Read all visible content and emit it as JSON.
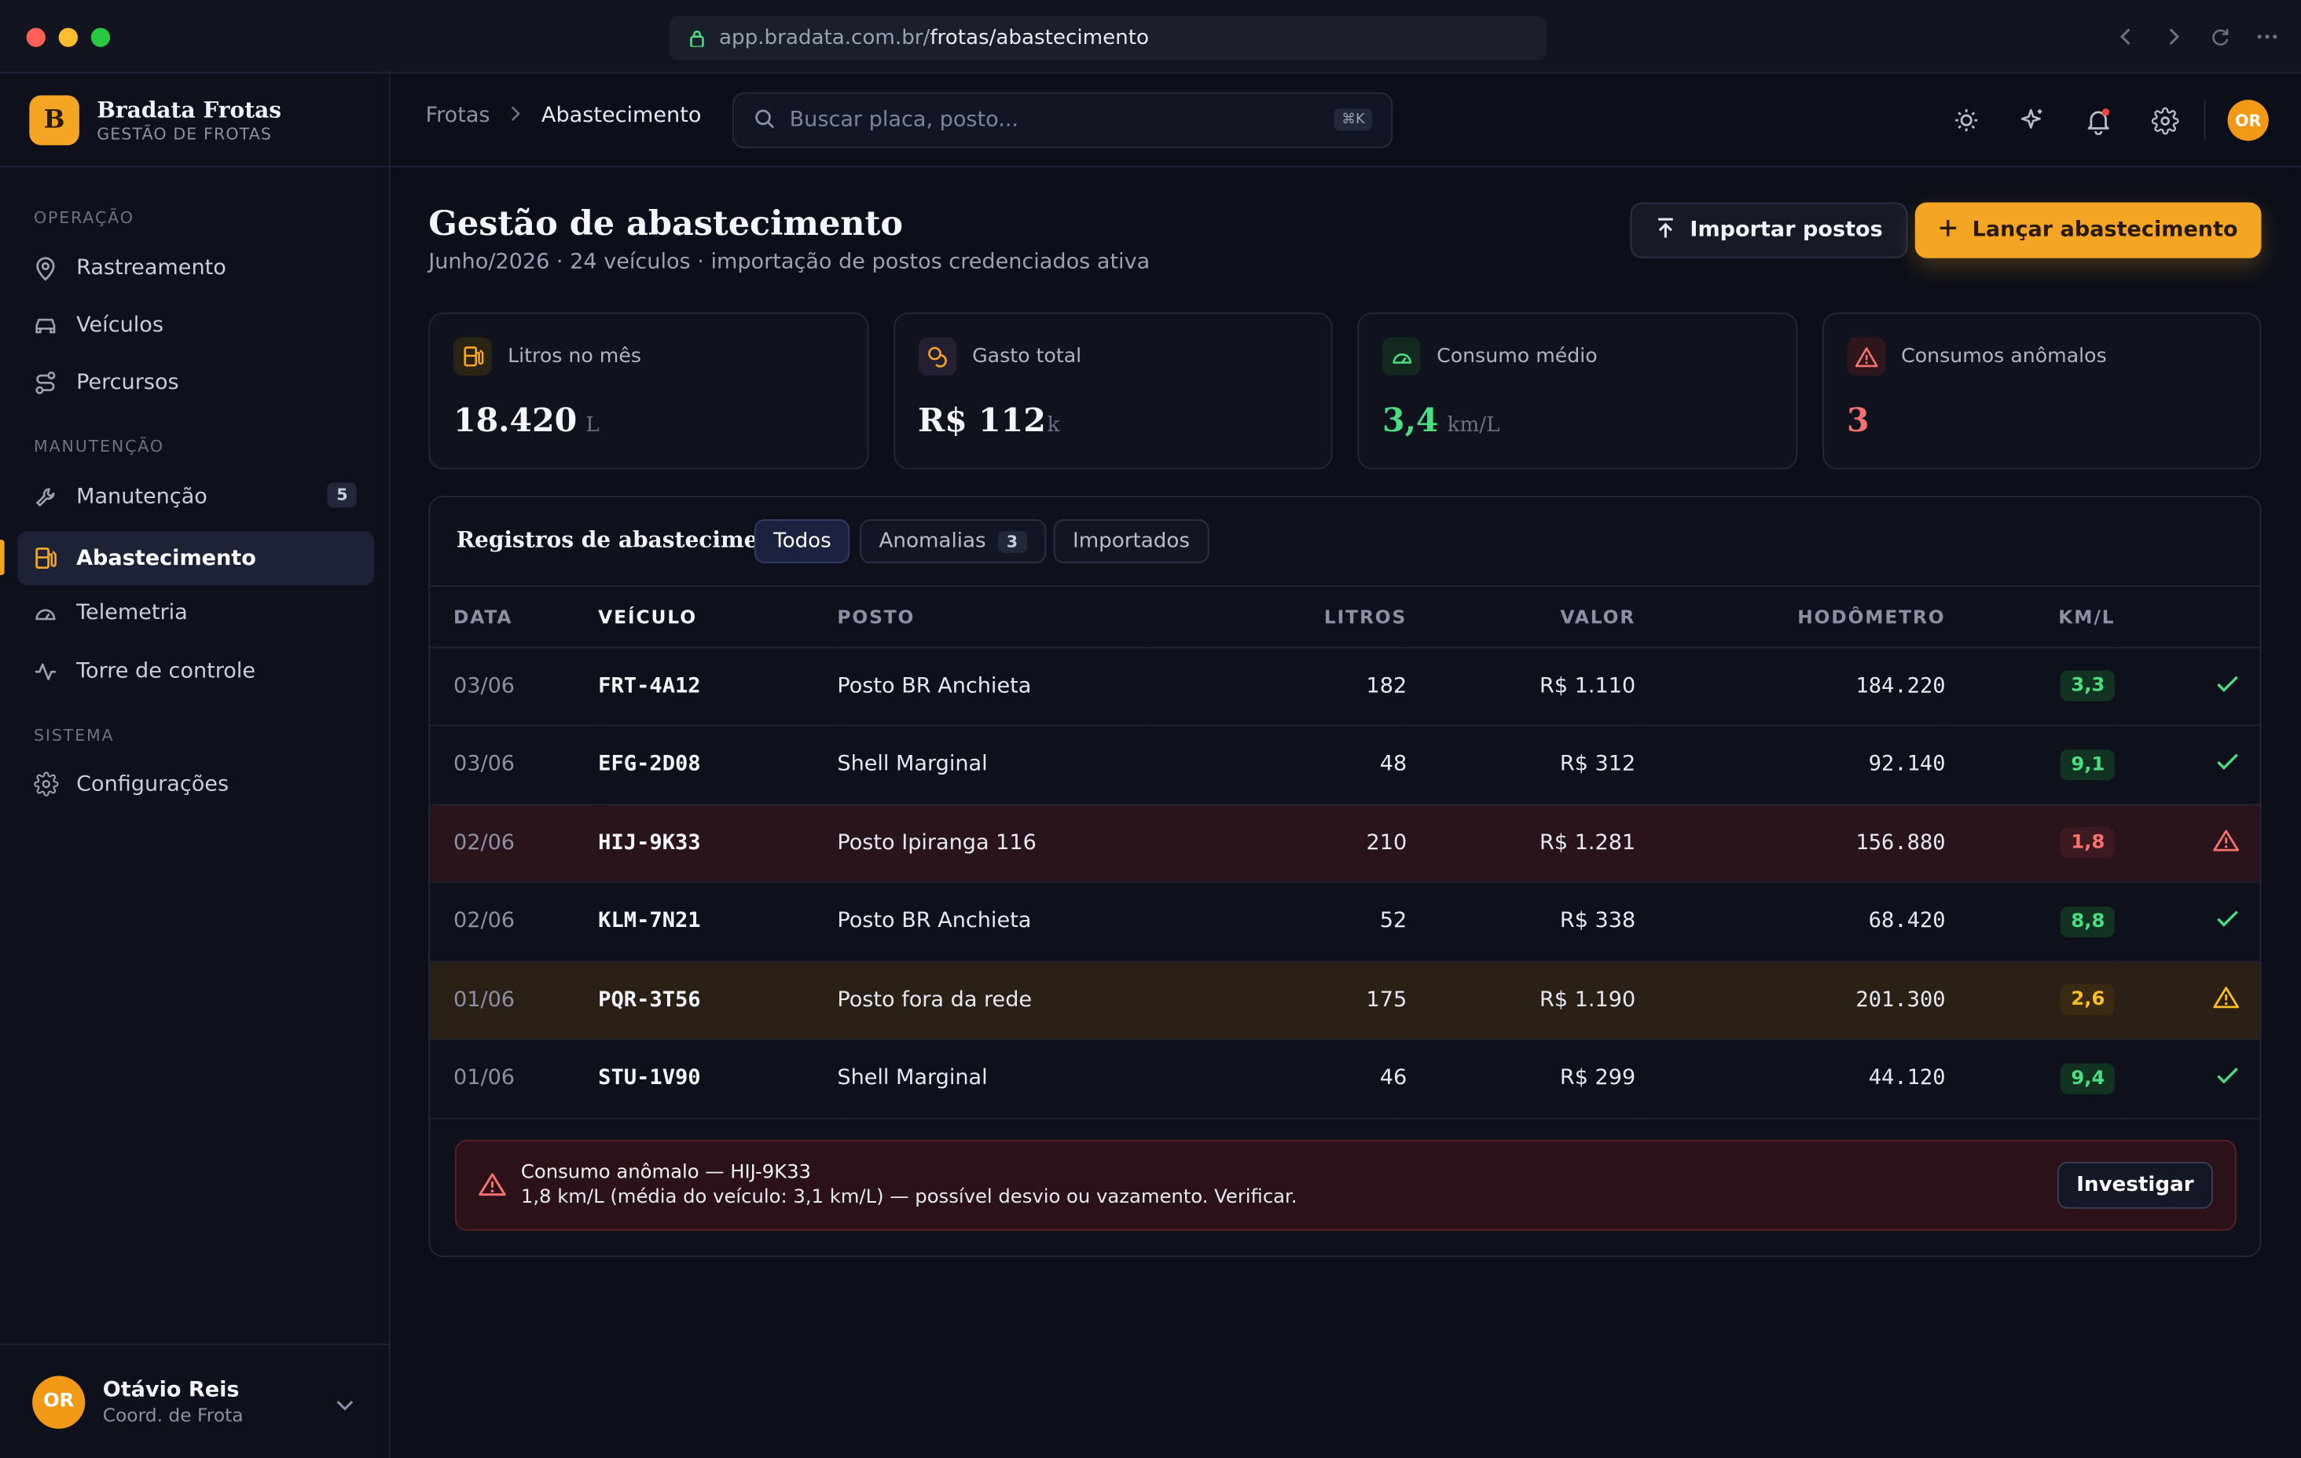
{
  "browser": {
    "url_host": "app.bradata.com.br/",
    "url_path": "frotas/abastecimento"
  },
  "brand": {
    "name": "Bradata Frotas",
    "subtitle": "GESTÃO DE FROTAS",
    "logo_letter": "B",
    "accent": "#f5a524"
  },
  "sidebar": {
    "sections": [
      {
        "label": "OPERAÇÃO"
      },
      {
        "label": "MANUTENÇÃO"
      },
      {
        "label": "SISTEMA"
      }
    ],
    "items": [
      {
        "label": "Rastreamento",
        "icon": "map-pin-icon"
      },
      {
        "label": "Veículos",
        "icon": "car-icon"
      },
      {
        "label": "Percursos",
        "icon": "route-icon"
      },
      {
        "label": "Manutenção",
        "icon": "wrench-icon",
        "badge": "5"
      },
      {
        "label": "Abastecimento",
        "icon": "fuel-icon",
        "active": true
      },
      {
        "label": "Telemetria",
        "icon": "gauge-icon"
      },
      {
        "label": "Torre de controle",
        "icon": "activity-icon"
      },
      {
        "label": "Configurações",
        "icon": "gear-icon"
      }
    ],
    "user": {
      "initials": "OR",
      "name": "Otávio Reis",
      "role": "Coord. de Frota"
    }
  },
  "topbar": {
    "breadcrumb": [
      "Frotas",
      "Abastecimento"
    ],
    "search_placeholder": "Buscar placa, posto...",
    "search_kbd": "⌘K",
    "avatar_initials": "OR",
    "tools": [
      "sun-icon",
      "sparkles-icon",
      "bell-icon",
      "gear-icon"
    ]
  },
  "page": {
    "title": "Gestão de abastecimento",
    "subtitle": "Junho/2026 · 24 veículos · importação de postos credenciados ativa",
    "import_button": "Importar postos",
    "primary_button": "Lançar abastecimento"
  },
  "kpis": [
    {
      "label": "Litros no mês",
      "value": "18.420",
      "unit": "L",
      "icon": "fuel-icon",
      "color": "#f4f6fb"
    },
    {
      "label": "Gasto total",
      "value": "R$ 112",
      "unit": "k",
      "icon": "coins-icon",
      "color": "#f4f6fb"
    },
    {
      "label": "Consumo médio",
      "value": "3,4",
      "unit": "km/L",
      "icon": "gauge-icon",
      "color": "#4ade80"
    },
    {
      "label": "Consumos anômalos",
      "value": "3",
      "unit": "",
      "icon": "warning-icon",
      "color": "#f87171"
    }
  ],
  "records": {
    "title": "Registros de abastecimento",
    "tabs": [
      {
        "label": "Todos",
        "active": true
      },
      {
        "label": "Anomalias",
        "count": "3"
      },
      {
        "label": "Importados"
      }
    ],
    "columns": [
      "DATA",
      "VEÍCULO",
      "POSTO",
      "LITROS",
      "VALOR",
      "HODÔMETRO",
      "KM/L"
    ],
    "rows": [
      {
        "date": "03/06",
        "vehicle": "FRT-4A12",
        "station": "Posto BR Anchieta",
        "liters": "182",
        "value": "R$ 1.110",
        "odometer": "184.220",
        "kml": "3,3",
        "status": "ok"
      },
      {
        "date": "03/06",
        "vehicle": "EFG-2D08",
        "station": "Shell Marginal",
        "liters": "48",
        "value": "R$ 312",
        "odometer": "92.140",
        "kml": "9,1",
        "status": "ok"
      },
      {
        "date": "02/06",
        "vehicle": "HIJ-9K33",
        "station": "Posto Ipiranga 116",
        "liters": "210",
        "value": "R$ 1.281",
        "odometer": "156.880",
        "kml": "1,8",
        "status": "danger"
      },
      {
        "date": "02/06",
        "vehicle": "KLM-7N21",
        "station": "Posto BR Anchieta",
        "liters": "52",
        "value": "R$ 338",
        "odometer": "68.420",
        "kml": "8,8",
        "status": "ok"
      },
      {
        "date": "01/06",
        "vehicle": "PQR-3T56",
        "station": "Posto fora da rede",
        "liters": "175",
        "value": "R$ 1.190",
        "odometer": "201.300",
        "kml": "2,6",
        "status": "warn"
      },
      {
        "date": "01/06",
        "vehicle": "STU-1V90",
        "station": "Shell Marginal",
        "liters": "46",
        "value": "R$ 299",
        "odometer": "44.120",
        "kml": "9,4",
        "status": "ok"
      }
    ],
    "alert": {
      "title": "Consumo anômalo — HIJ-9K33",
      "message": "1,8 km/L (média do veículo: 3,1 km/L) — possível desvio ou vazamento. Verificar.",
      "button": "Investigar"
    }
  }
}
